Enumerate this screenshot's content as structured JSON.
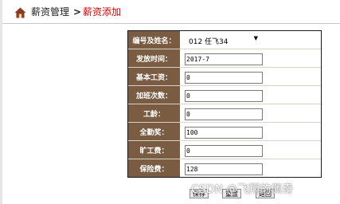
{
  "breadcrumb": {
    "root": "薪资管理",
    "separator": ">",
    "current": "薪资添加"
  },
  "form": {
    "rows": [
      {
        "label": "编号及姓名：",
        "type": "select",
        "value": "012 任飞34"
      },
      {
        "label": "发放时间：",
        "type": "text",
        "value": "2017-7"
      },
      {
        "label": "基本工资：",
        "type": "text",
        "value": "0"
      },
      {
        "label": "加班次数：",
        "type": "text",
        "value": "0"
      },
      {
        "label": "工龄：",
        "type": "text",
        "value": "0"
      },
      {
        "label": "全勤奖：",
        "type": "text",
        "value": "100"
      },
      {
        "label": "旷工费：",
        "type": "text",
        "value": "0"
      },
      {
        "label": "保险费：",
        "type": "text",
        "value": "128"
      }
    ]
  },
  "buttons": {
    "save": "保存",
    "reset": "重置",
    "back": "返回"
  },
  "watermark": "CSDN @飞翔的佩奇",
  "colors": {
    "label_bg": "#7a5c43",
    "breadcrumb_current": "#e40000"
  },
  "icons": {
    "home": "home-icon",
    "dropdown": "chevron-down-icon"
  }
}
